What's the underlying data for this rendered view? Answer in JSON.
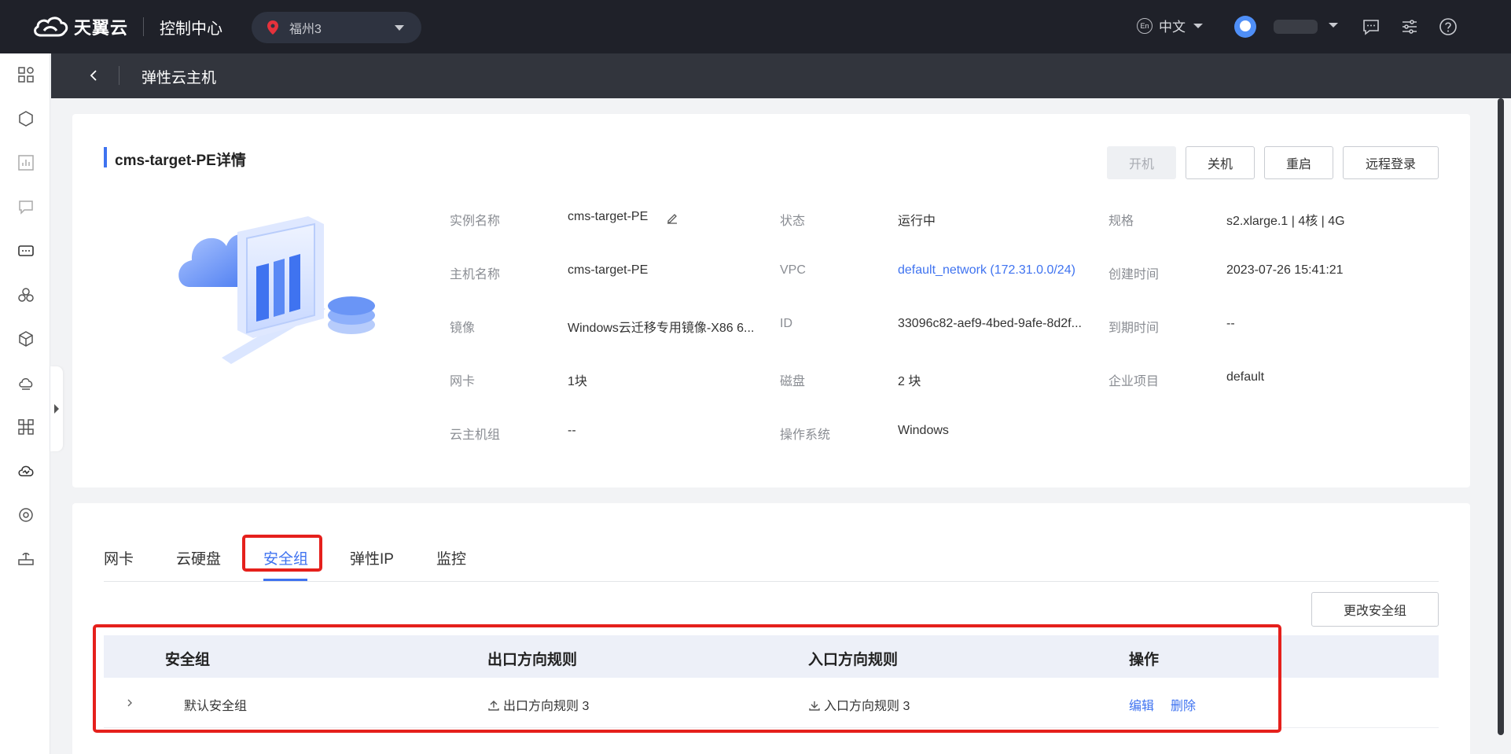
{
  "header": {
    "brand": "天翼云",
    "console_title": "控制中心",
    "region": "福州3",
    "language": "中文",
    "language_badge": "En"
  },
  "subheader": {
    "title": "弹性云主机"
  },
  "detail": {
    "title": "cms-target-PE详情",
    "actions": {
      "start": "开机",
      "shutdown": "关机",
      "restart": "重启",
      "remote_login": "远程登录"
    },
    "fields": {
      "instance_name": {
        "label": "实例名称",
        "value": "cms-target-PE"
      },
      "status": {
        "label": "状态",
        "value": "运行中"
      },
      "spec": {
        "label": "规格",
        "value": "s2.xlarge.1 | 4核 | 4G"
      },
      "host_name": {
        "label": "主机名称",
        "value": "cms-target-PE"
      },
      "vpc": {
        "label": "VPC",
        "value": "default_network (172.31.0.0/24)"
      },
      "created_at": {
        "label": "创建时间",
        "value": "2023-07-26 15:41:21"
      },
      "image": {
        "label": "镜像",
        "value": "Windows云迁移专用镜像-X86 6..."
      },
      "id": {
        "label": "ID",
        "value": "33096c82-aef9-4bed-9afe-8d2f..."
      },
      "expire_at": {
        "label": "到期时间",
        "value": "--"
      },
      "nic": {
        "label": "网卡",
        "value": "1块"
      },
      "disk": {
        "label": "磁盘",
        "value": "2 块"
      },
      "enterprise_project": {
        "label": "企业项目",
        "value": "default"
      },
      "host_group": {
        "label": "云主机组",
        "value": "--"
      },
      "os": {
        "label": "操作系统",
        "value": "Windows"
      }
    }
  },
  "tabs": {
    "items": [
      "网卡",
      "云硬盘",
      "安全组",
      "弹性IP",
      "监控"
    ],
    "active": "安全组"
  },
  "security_groups": {
    "change_button": "更改安全组",
    "columns": {
      "name": "安全组",
      "egress": "出口方向规则",
      "ingress": "入口方向规则",
      "actions": "操作"
    },
    "rows": [
      {
        "name": "默认安全组",
        "egress": "出口方向规则 3",
        "ingress": "入口方向规则 3",
        "edit": "编辑",
        "delete": "删除"
      }
    ]
  },
  "colors": {
    "accent": "#3f73f0",
    "highlight": "#e5201c",
    "topbar": "#1f2129"
  }
}
